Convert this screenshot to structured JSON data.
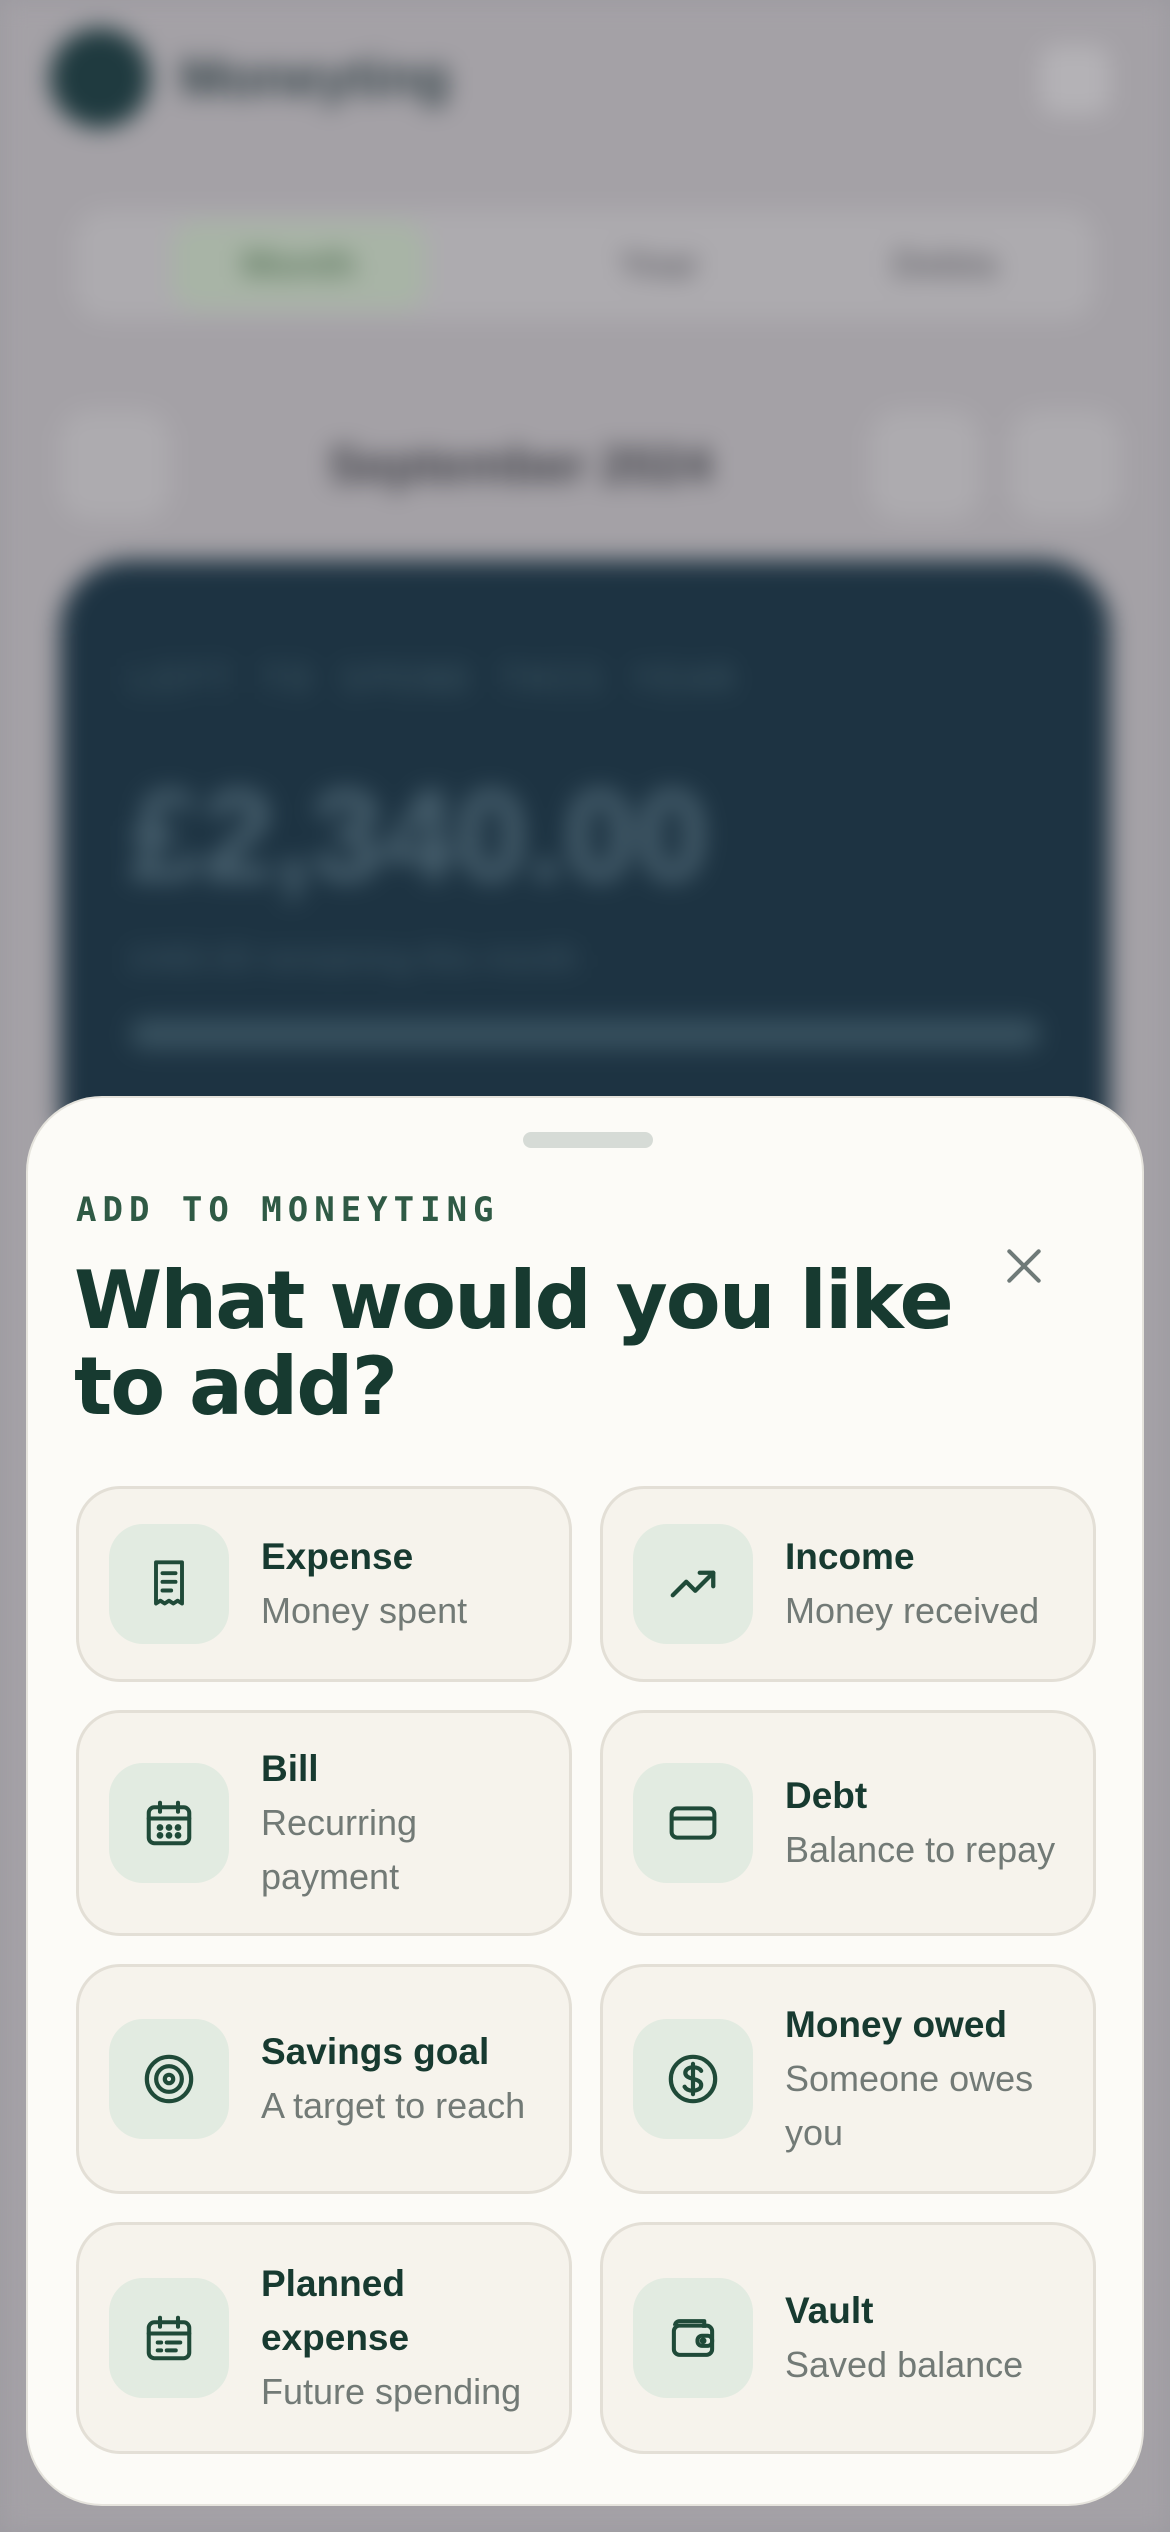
{
  "background": {
    "brand": "Moneyting",
    "tabs": [
      "Month",
      "Year",
      "Debts"
    ],
    "month": "September 2024",
    "card_label": "LEFT TO SPEND THIS YEAR",
    "card_amount": "£2,340.00",
    "card_sub": "£460.00 remaining this month"
  },
  "sheet": {
    "eyebrow": "ADD TO MONEYTING",
    "title": "What would you like to add?",
    "close_icon": "close-icon"
  },
  "options": [
    {
      "title": "Expense",
      "subtitle": "Money spent",
      "icon": "receipt-icon"
    },
    {
      "title": "Income",
      "subtitle": "Money received",
      "icon": "trending-up-icon"
    },
    {
      "title": "Bill",
      "subtitle": "Recurring payment",
      "icon": "calendar-icon"
    },
    {
      "title": "Debt",
      "subtitle": "Balance to repay",
      "icon": "credit-card-icon"
    },
    {
      "title": "Savings goal",
      "subtitle": "A target to reach",
      "icon": "target-icon"
    },
    {
      "title": "Money owed",
      "subtitle": "Someone owes you",
      "icon": "dollar-circle-icon"
    },
    {
      "title": "Planned expense",
      "subtitle": "Future spending",
      "icon": "calendar-list-icon"
    },
    {
      "title": "Vault",
      "subtitle": "Saved balance",
      "icon": "wallet-icon"
    }
  ],
  "colors": {
    "accent": "#173a30",
    "icon_bg": "#e2ebe1",
    "card_bg": "#f6f3ec"
  }
}
